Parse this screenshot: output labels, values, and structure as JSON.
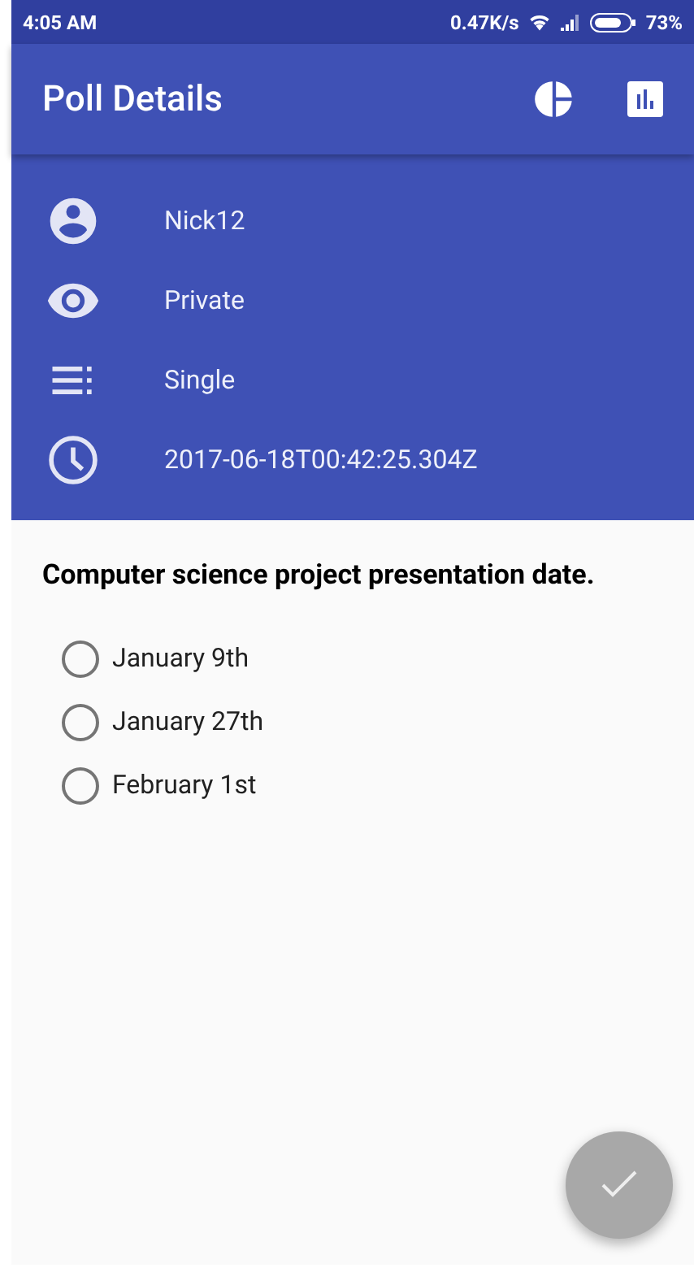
{
  "status_bar": {
    "time": "4:05 AM",
    "speed": "0.47K/s",
    "battery": "73%"
  },
  "app_bar": {
    "title": "Poll Details"
  },
  "info": [
    {
      "kind": "user",
      "text": "Nick12"
    },
    {
      "kind": "visibility",
      "text": "Private"
    },
    {
      "kind": "type",
      "text": "Single"
    },
    {
      "kind": "time",
      "text": "2017-06-18T00:42:25.304Z"
    }
  ],
  "question": "Computer science project presentation date.",
  "options": [
    {
      "label": "January 9th",
      "selected": false
    },
    {
      "label": "January 27th",
      "selected": false
    },
    {
      "label": "February 1st",
      "selected": false
    }
  ],
  "submit_button": {
    "disabled": true
  }
}
